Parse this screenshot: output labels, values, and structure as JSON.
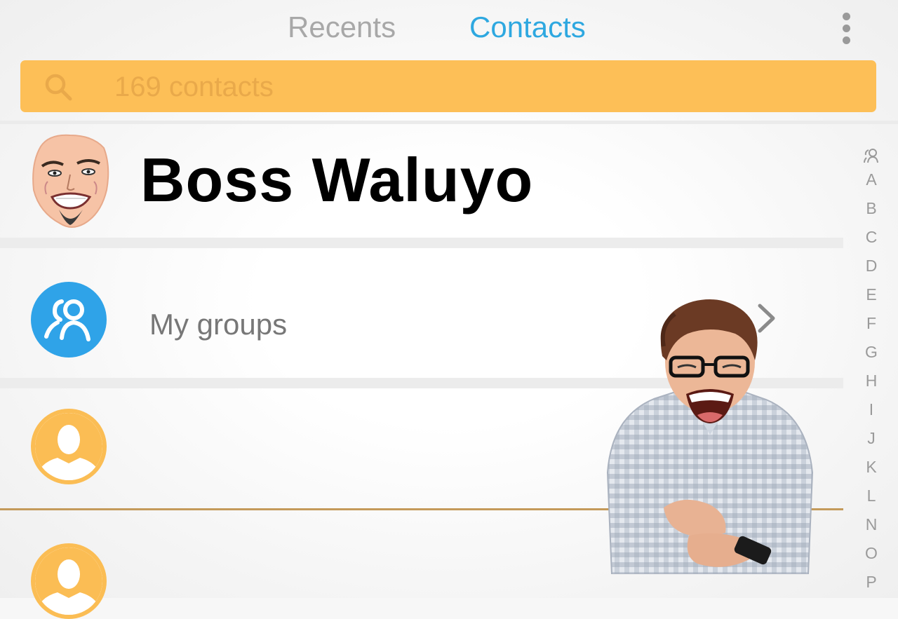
{
  "tabs": [
    {
      "label": "Recents",
      "active": false
    },
    {
      "label": "Contacts",
      "active": true
    }
  ],
  "colors": {
    "accent_blue": "#2ea8e0",
    "search_bg": "#fdbf57",
    "avatar_orange": "#fbbd54",
    "group_blue": "#2fa3e8"
  },
  "search": {
    "placeholder": "169 contacts",
    "icon": "search-icon"
  },
  "menu": {
    "icon": "more-vertical-icon"
  },
  "contacts": {
    "top_contact": {
      "name": "Boss Waluyo",
      "avatar": "cartoon-face-avatar"
    },
    "groups": {
      "label": "My groups",
      "icon": "group-icon",
      "chevron": "chevron-right-icon"
    },
    "placeholders": [
      {
        "avatar": "person-silhouette-icon"
      },
      {
        "avatar": "person-silhouette-icon"
      }
    ]
  },
  "index": {
    "icon": "group-mini-icon",
    "letters": [
      "A",
      "B",
      "C",
      "D",
      "E",
      "F",
      "G",
      "H",
      "I",
      "J",
      "K",
      "L",
      "N",
      "O",
      "P"
    ]
  },
  "overlay": {
    "image": "laughing-man-with-phone"
  }
}
